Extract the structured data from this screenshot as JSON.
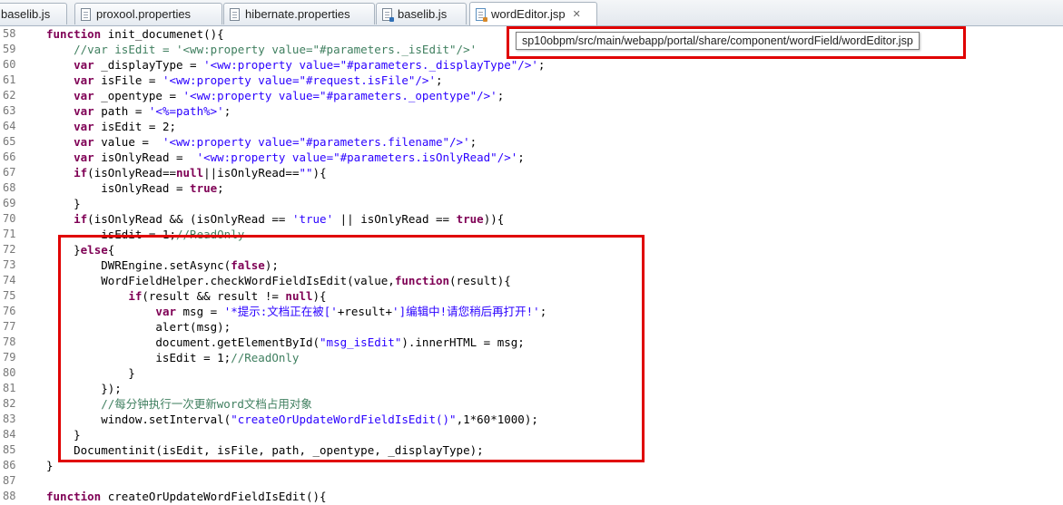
{
  "tabs": [
    {
      "label": "baselib.js",
      "icon": "js-file-icon",
      "active": false
    },
    {
      "label": "proxool.properties",
      "icon": "properties-file-icon",
      "active": false
    },
    {
      "label": "hibernate.properties",
      "icon": "properties-file-icon",
      "active": false
    },
    {
      "label": "baselib.js",
      "icon": "js-file-icon",
      "active": false
    },
    {
      "label": "wordEditor.jsp",
      "icon": "jsp-file-icon",
      "active": true
    }
  ],
  "tab_close_symbol": "✕",
  "tooltip": "sp10obpm/src/main/webapp/portal/share/component/wordField/wordEditor.jsp",
  "colors": {
    "keyword": "#7f0055",
    "string": "#2a00ff",
    "comment": "#3f7f5f",
    "annotation_box": "#e00000"
  },
  "code_lines": [
    {
      "n": "58",
      "text": "function init_documenet(){"
    },
    {
      "n": "59",
      "text": "    //var isEdit = '<ww:property value=\"#parameters._isEdit\"/>'"
    },
    {
      "n": "60",
      "text": "    var _displayType = '<ww:property value=\"#parameters._displayType\"/>';"
    },
    {
      "n": "61",
      "text": "    var isFile = '<ww:property value=\"#request.isFile\"/>';"
    },
    {
      "n": "62",
      "text": "    var _opentype = '<ww:property value=\"#parameters._opentype\"/>';"
    },
    {
      "n": "63",
      "text": "    var path = '<%=path%>';"
    },
    {
      "n": "64",
      "text": "    var isEdit = 2;"
    },
    {
      "n": "65",
      "text": "    var value =  '<ww:property value=\"#parameters.filename\"/>';"
    },
    {
      "n": "66",
      "text": "    var isOnlyRead =  '<ww:property value=\"#parameters.isOnlyRead\"/>';"
    },
    {
      "n": "67",
      "text": "    if(isOnlyRead==null||isOnlyRead==\"\"){"
    },
    {
      "n": "68",
      "text": "        isOnlyRead = true;"
    },
    {
      "n": "69",
      "text": "    }"
    },
    {
      "n": "70",
      "text": "    if(isOnlyRead && (isOnlyRead == 'true' || isOnlyRead == true)){"
    },
    {
      "n": "71",
      "text": "        isEdit = 1;//ReadOnly"
    },
    {
      "n": "72",
      "text": "    }else{"
    },
    {
      "n": "73",
      "text": "        DWREngine.setAsync(false);"
    },
    {
      "n": "74",
      "text": "        WordFieldHelper.checkWordFieldIsEdit(value,function(result){"
    },
    {
      "n": "75",
      "text": "            if(result && result != null){"
    },
    {
      "n": "76",
      "text": "                var msg = '*提示:文档正在被['+result+']编辑中!请您稍后再打开!';"
    },
    {
      "n": "77",
      "text": "                alert(msg);"
    },
    {
      "n": "78",
      "text": "                document.getElementById(\"msg_isEdit\").innerHTML = msg;"
    },
    {
      "n": "79",
      "text": "                isEdit = 1;//ReadOnly"
    },
    {
      "n": "80",
      "text": "            }"
    },
    {
      "n": "81",
      "text": "        });"
    },
    {
      "n": "82",
      "text": "        //每分钟执行一次更新word文档占用对象"
    },
    {
      "n": "83",
      "text": "        window.setInterval(\"createOrUpdateWordFieldIsEdit()\",1*60*1000);"
    },
    {
      "n": "84",
      "text": "    }"
    },
    {
      "n": "85",
      "text": "    Documentinit(isEdit, isFile, path, _opentype, _displayType);"
    },
    {
      "n": "86",
      "text": "}"
    },
    {
      "n": "87",
      "text": ""
    },
    {
      "n": "88",
      "text": "function createOrUpdateWordFieldIsEdit(){"
    }
  ]
}
